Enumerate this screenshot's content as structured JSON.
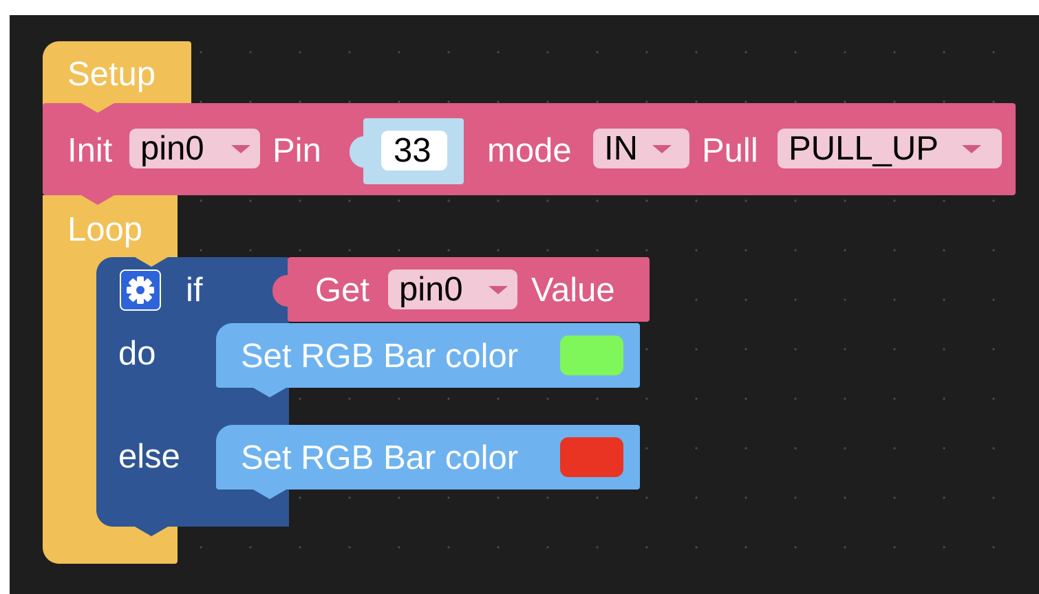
{
  "setup_block": {
    "label": "Setup",
    "color": "#f1c057"
  },
  "init_block": {
    "label_init": "Init",
    "pin_var": "pin0",
    "label_pin": "Pin",
    "pin_number": "33",
    "label_mode": "mode",
    "mode_value": "IN",
    "label_pull": "Pull",
    "pull_value": "PULL_UP",
    "color": "#dd5d84",
    "value_color": "#b9dcf1"
  },
  "loop_block": {
    "label": "Loop",
    "color": "#f1c057"
  },
  "if_block": {
    "label_if": "if",
    "label_do": "do",
    "label_else": "else",
    "color": "#2f5594",
    "gear_color": "#2e63d9"
  },
  "get_block": {
    "label_get": "Get",
    "pin_var": "pin0",
    "label_value": "Value",
    "color": "#dd5d84"
  },
  "set_rgb_do": {
    "label": "Set RGB Bar color",
    "swatch_color": "#7ff65a",
    "color": "#6eb3ef"
  },
  "set_rgb_else": {
    "label": "Set RGB Bar color",
    "swatch_color": "#e93323",
    "color": "#6eb3ef"
  }
}
